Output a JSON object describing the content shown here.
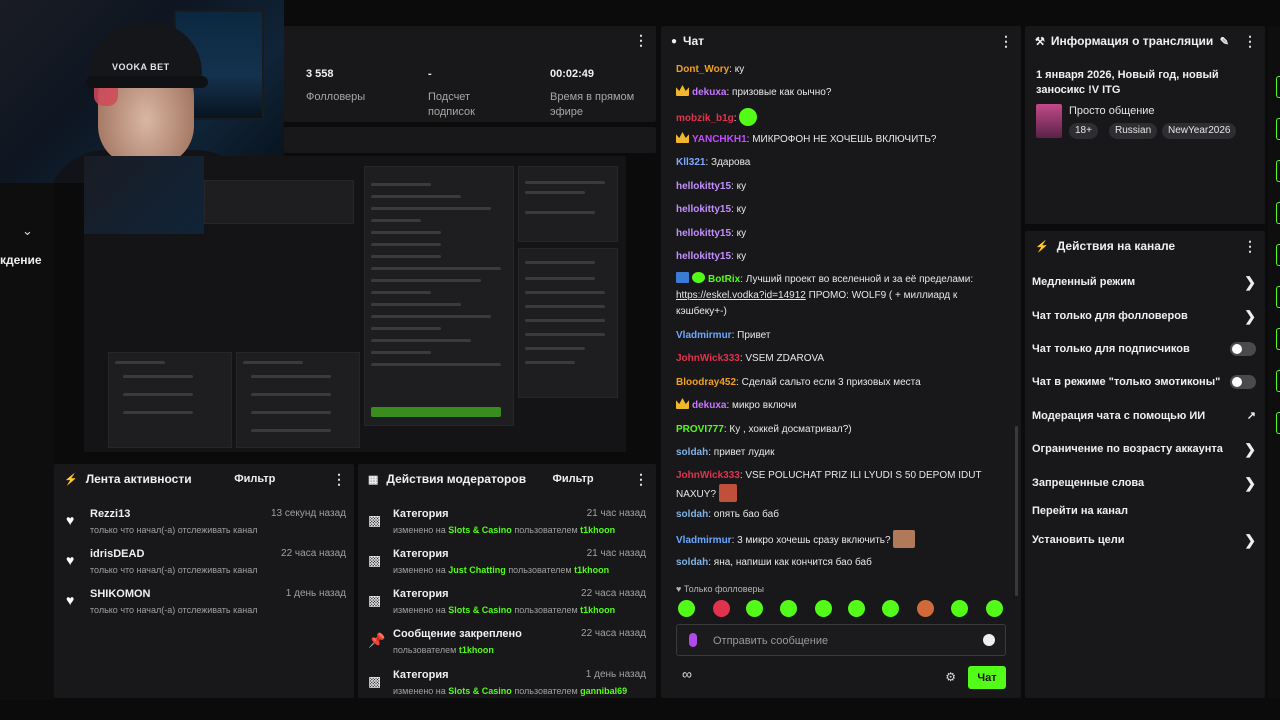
{
  "stats": {
    "followers_value": "3 558",
    "followers_label": "Фолловеры",
    "subs_value": "-",
    "subs_label": "Подсчет подписок",
    "live_value": "00:02:49",
    "live_label": "Время в прямом эфире"
  },
  "webcam": {
    "cap_text": "VOOKA BET"
  },
  "left_strip": {
    "label": "кдение"
  },
  "activity": {
    "title": "Лента активности",
    "filter": "Фильтр",
    "items": [
      {
        "name": "Rezzi13",
        "time": "13 секунд назад",
        "desc": "только что начал(-а) отслеживать канал"
      },
      {
        "name": "idrisDEAD",
        "time": "22 часа назад",
        "desc": "только что начал(-а) отслеживать канал"
      },
      {
        "name": "SHIKOMON",
        "time": "1 день назад",
        "desc": "только что начал(-а) отслеживать канал"
      }
    ]
  },
  "mod": {
    "title": "Действия модераторов",
    "filter": "Фильтр",
    "items": [
      {
        "name": "Категория",
        "time": "21 час назад",
        "pre": "изменено на",
        "hl": "Slots & Casino",
        "mid": "пользователем",
        "user": "t1khoon"
      },
      {
        "name": "Категория",
        "time": "21 час назад",
        "pre": "изменено на",
        "hl": "Just Chatting",
        "mid": "пользователем",
        "user": "t1khoon"
      },
      {
        "name": "Категория",
        "time": "22 часа назад",
        "pre": "изменено на",
        "hl": "Slots & Casino",
        "mid": "пользователем",
        "user": "t1khoon"
      },
      {
        "name": "Сообщение закреплено",
        "time": "22 часа назад",
        "pre": "пользователем",
        "hl": "",
        "mid": "",
        "user": "t1khoon"
      },
      {
        "name": "Категория",
        "time": "1 день назад",
        "pre": "изменено на",
        "hl": "Slots & Casino",
        "mid": "пользователем",
        "user": "gannibal69"
      }
    ]
  },
  "chat": {
    "title": "Чат",
    "messages": [
      {
        "user": "Dont_Wory",
        "color": "#f0a020",
        "badge": "",
        "text": "ку"
      },
      {
        "user": "dekuxa",
        "color": "#c678ff",
        "badge": "crown",
        "text": "призовые как оычно?"
      },
      {
        "user": "mobzik_b1g",
        "color": "#e0334e",
        "badge": "",
        "text": ""
      },
      {
        "user": "YANCHKH1",
        "color": "#c34cff",
        "badge": "crown",
        "text": "МИКРОФОН НЕ ХОЧЕШЬ ВКЛЮЧИТЬ?"
      },
      {
        "user": "Kll321",
        "color": "#7fa8ff",
        "badge": "",
        "text": "Здарова"
      },
      {
        "user": "hellokitty15",
        "color": "#c390ff",
        "badge": "",
        "text": "ку"
      },
      {
        "user": "hellokitty15",
        "color": "#c390ff",
        "badge": "",
        "text": "ку"
      },
      {
        "user": "hellokitty15",
        "color": "#c390ff",
        "badge": "",
        "text": "ку"
      },
      {
        "user": "hellokitty15",
        "color": "#c390ff",
        "badge": "",
        "text": "ку"
      },
      {
        "user": "BotRix",
        "color": "#53fc18",
        "badge": "bot",
        "text": "Лучший проект во вселенной и за её пределами:",
        "link": "https://eskel.vodka?id=14912",
        "after": "ПРОМО: WOLF9 ( + миллиард к кэшбеку+-)"
      },
      {
        "user": "Vladmirmur",
        "color": "#6aa8ff",
        "badge": "",
        "text": "Привет"
      },
      {
        "user": "JohnWick333",
        "color": "#e0334e",
        "badge": "",
        "text": "VSEM ZDAROVA"
      },
      {
        "user": "Bloodray452",
        "color": "#f0a020",
        "badge": "",
        "text": "Сделай сальто если 3 призовых места"
      },
      {
        "user": "dekuxa",
        "color": "#c678ff",
        "badge": "crown",
        "text": "микро включи"
      },
      {
        "user": "PROVI777",
        "color": "#53fc18",
        "badge": "",
        "text": "Ку , хоккей досматривал?)"
      },
      {
        "user": "soldah",
        "color": "#7fb2e6",
        "badge": "",
        "text": "привет лудик"
      },
      {
        "user": "JohnWick333",
        "color": "#e0334e",
        "badge": "",
        "text": "VSE POLUCHAT PRIZ ILI LYUDI S 50 DEPOM IDUT NAXUY?"
      },
      {
        "user": "soldah",
        "color": "#7fb2e6",
        "badge": "",
        "text": "опять бао баб"
      },
      {
        "user": "Vladmirmur",
        "color": "#6aa8ff",
        "badge": "",
        "text": "3 микро хочешь сразу включить?"
      },
      {
        "user": "soldah",
        "color": "#7fb2e6",
        "badge": "",
        "text": "яна, напиши как кончится бао баб"
      }
    ],
    "followers_only": "Только фолловеры",
    "input_placeholder": "Отправить сообщение",
    "send_label": "Чат"
  },
  "info": {
    "title": "Информация о трансляции",
    "stream_title": "1 января 2026, Новый год, новый заносикс !V ITG",
    "category": "Просто общение",
    "tags": [
      "18+",
      "Russian",
      "NewYear2026"
    ]
  },
  "channel": {
    "title": "Действия на канале",
    "items": [
      {
        "label": "Медленный режим",
        "type": "arrow"
      },
      {
        "label": "Чат только для фолловеров",
        "type": "arrow"
      },
      {
        "label": "Чат только для подписчиков",
        "type": "toggle"
      },
      {
        "label": "Чат в режиме \"только эмотиконы\"",
        "type": "toggle"
      },
      {
        "label": "Модерация чата с помощью ИИ",
        "type": "external"
      },
      {
        "label": "Ограничение по возрасту аккаунта",
        "type": "arrow"
      },
      {
        "label": "Запрещенные слова",
        "type": "arrow"
      },
      {
        "label": "Перейти на канал",
        "type": "none"
      },
      {
        "label": "Установить цели",
        "type": "arrow"
      }
    ]
  },
  "colors": {
    "accent": "#53fc18",
    "panel": "#18181a",
    "background": "#0b0b0c"
  }
}
